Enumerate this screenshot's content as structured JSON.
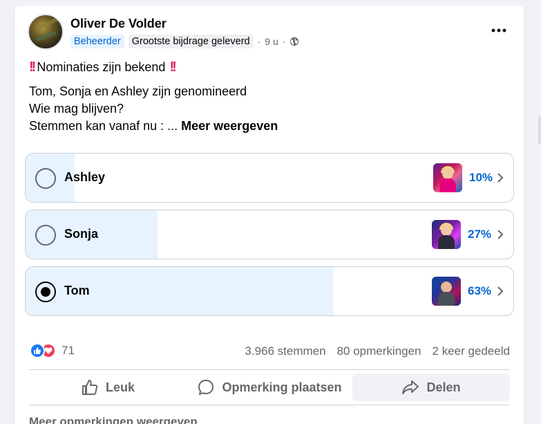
{
  "post": {
    "author": "Oliver De Volder",
    "badge_admin": "Beheerder",
    "badge_top": "Grootste bijdrage geleverd",
    "separator": "·",
    "time": "9 u",
    "title_text": "Nominaties zijn bekend",
    "body_line1": "Tom, Sonja en Ashley zijn genomineerd",
    "body_line2": "Wie mag blijven?",
    "body_line3": "Stemmen kan vanaf nu : ...",
    "see_more": "Meer weergeven"
  },
  "poll": {
    "options": [
      {
        "label": "Ashley",
        "percent_text": "10%",
        "percent": 10,
        "selected": false
      },
      {
        "label": "Sonja",
        "percent_text": "27%",
        "percent": 27,
        "selected": false
      },
      {
        "label": "Tom",
        "percent_text": "63%",
        "percent": 63,
        "selected": true
      }
    ]
  },
  "stats": {
    "reaction_count": "71",
    "votes": "3.966 stemmen",
    "comments": "80 opmerkingen",
    "shares": "2 keer gedeeld"
  },
  "actions": {
    "like": "Leuk",
    "comment": "Opmerking plaatsen",
    "share": "Delen"
  },
  "footer": {
    "more_comments": "Meer opmerkingen weergeven"
  },
  "icons": {
    "menu": "more-horizontal-icon",
    "audience": "globe-icon",
    "like": "thumbs-up-icon",
    "comment": "speech-bubble-icon",
    "share": "share-arrow-icon"
  },
  "colors": {
    "accent": "#0064d1",
    "poll_fill": "#e7f3ff",
    "like": "#1877f2",
    "love": "#f33e58"
  }
}
